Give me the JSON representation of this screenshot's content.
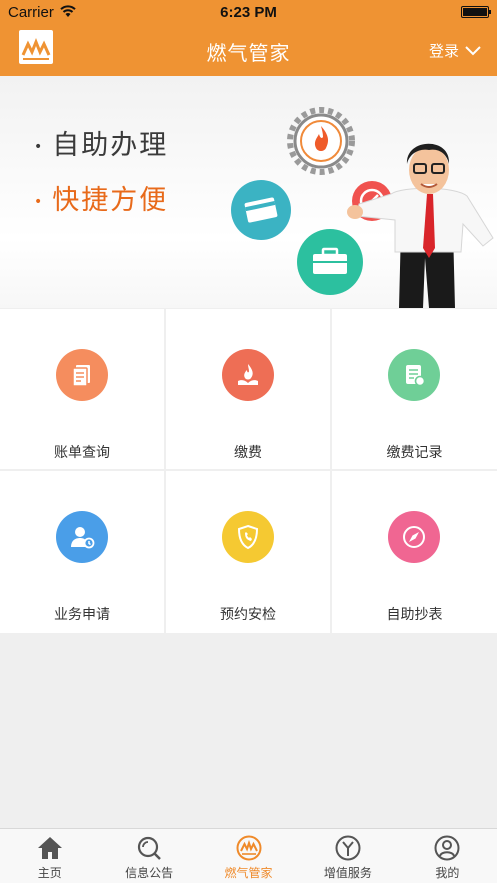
{
  "status_bar": {
    "carrier": "Carrier",
    "time": "6:23 PM"
  },
  "nav": {
    "title": "燃气管家",
    "login_label": "登录"
  },
  "banner": {
    "slogan_1": "自助办理",
    "slogan_2": "快捷方便",
    "bullet": "•"
  },
  "grid": {
    "items": [
      {
        "label": "账单查询",
        "color": "#f58d5e",
        "icon": "bill-icon"
      },
      {
        "label": "缴费",
        "color": "#ee6e55",
        "icon": "flame-icon"
      },
      {
        "label": "缴费记录",
        "color": "#6fcf97",
        "icon": "record-icon"
      },
      {
        "label": "业务申请",
        "color": "#4a9ee8",
        "icon": "user-apply-icon"
      },
      {
        "label": "预约安检",
        "color": "#f5c932",
        "icon": "shield-phone-icon"
      },
      {
        "label": "自助抄表",
        "color": "#f06692",
        "icon": "compass-icon"
      }
    ]
  },
  "tabbar": {
    "tabs": [
      {
        "label": "主页",
        "icon": "home-icon"
      },
      {
        "label": "信息公告",
        "icon": "search-icon"
      },
      {
        "label": "燃气管家",
        "icon": "gas-logo-icon",
        "active": true
      },
      {
        "label": "增值服务",
        "icon": "value-service-icon"
      },
      {
        "label": "我的",
        "icon": "profile-icon"
      }
    ]
  },
  "colors": {
    "accent": "#ef9333",
    "active_tab": "#ef8a2a"
  }
}
